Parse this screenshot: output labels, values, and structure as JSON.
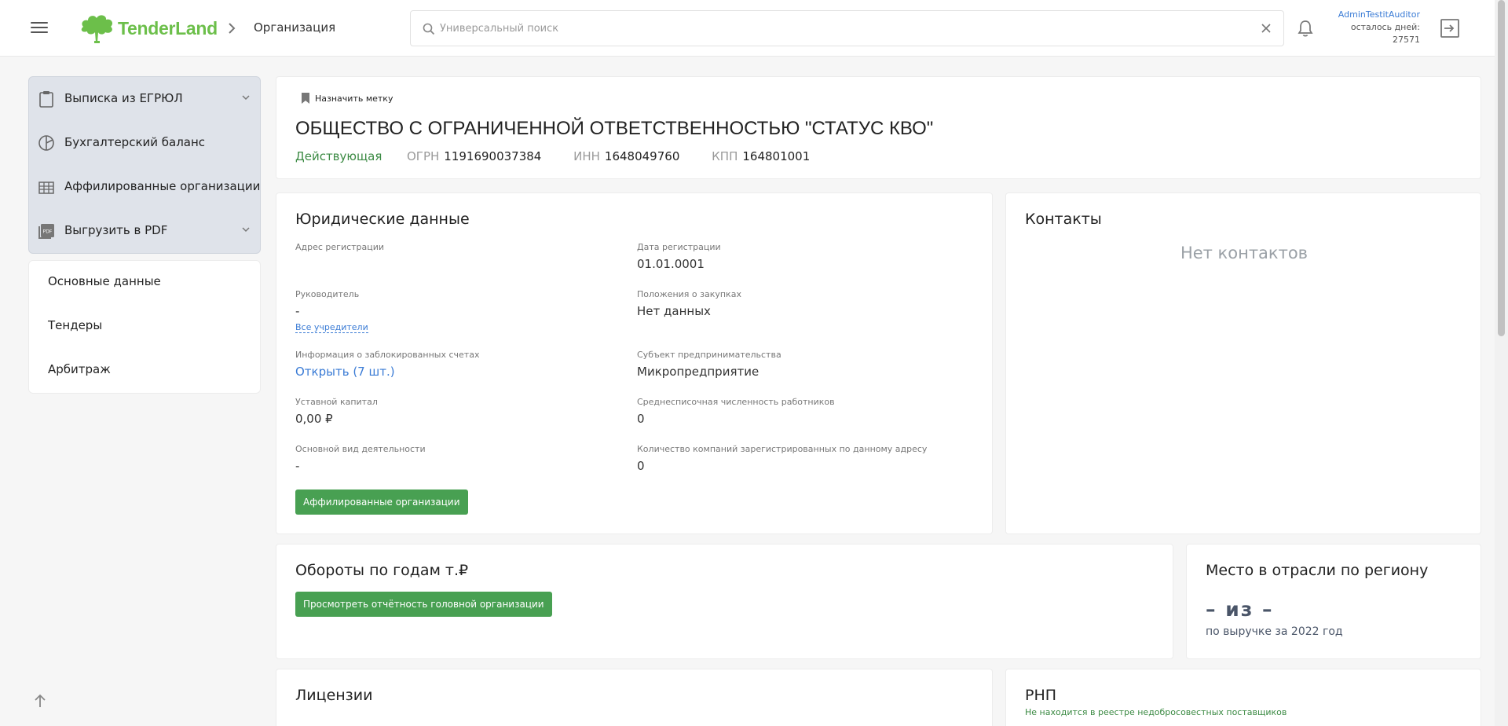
{
  "header": {
    "logo_text": "TenderLand",
    "breadcrumb": "Организация",
    "search": {
      "placeholder": "Универсальный поиск",
      "value": ""
    },
    "user": {
      "name": "AdminTestitAuditor",
      "days_label": "осталось дней:",
      "days_value": "27571"
    },
    "brand_color": "#6cbf4a"
  },
  "sidebar": {
    "tools": [
      {
        "label": "Выписка из ЕГРЮЛ",
        "icon": "clipboard-icon",
        "has_dropdown": true
      },
      {
        "label": "Бухгалтерский баланс",
        "icon": "pie-chart-icon",
        "has_dropdown": false
      },
      {
        "label": "Аффилированные организации",
        "icon": "building-icon",
        "has_dropdown": false
      },
      {
        "label": "Выгрузить в PDF",
        "icon": "pdf-icon",
        "has_dropdown": true
      }
    ],
    "nav": [
      {
        "label": "Основные данные"
      },
      {
        "label": "Тендеры"
      },
      {
        "label": "Арбитраж"
      }
    ]
  },
  "org": {
    "mark_label": "Назначить метку",
    "name": "ОБЩЕСТВО С ОГРАНИЧЕННОЙ ОТВЕТСТВЕННОСТЬЮ \"СТАТУС КВО\"",
    "status": "Действующая",
    "status_color": "#3b8a43",
    "ogrn_label": "ОГРН",
    "ogrn": "1191690037384",
    "inn_label": "ИНН",
    "inn": "1648049760",
    "kpp_label": "КПП",
    "kpp": "164801001"
  },
  "legal": {
    "title": "Юридические данные",
    "address_label": "Адрес регистрации",
    "reg_date_label": "Дата регистрации",
    "reg_date": "01.01.0001",
    "director_label": "Руководитель",
    "director": "-",
    "founders_link": "Все учредители",
    "procurement_label": "Положения о закупках",
    "procurement": "Нет данных",
    "blocked_label": "Информация о заблокированных счетах",
    "blocked_link": "Открыть (7 шт.)",
    "subject_label": "Субъект предпринимательства",
    "subject": "Микропредприятие",
    "capital_label": "Уставной капитал",
    "capital": "0,00 ₽",
    "employees_label": "Среднесписочная численность работников",
    "employees": "0",
    "activity_label": "Основной вид деятельности",
    "activity": "-",
    "companies_label": "Количество компаний зарегистрированных по данному адресу",
    "companies": "0",
    "affiliated_button": "Аффилированные организации"
  },
  "contacts": {
    "title": "Контакты",
    "empty": "Нет контактов"
  },
  "turnover": {
    "title": "Обороты по годам т.₽",
    "button": "Просмотреть отчётность головной организации"
  },
  "rank": {
    "title": "Место в отрасли по региону",
    "value": "– из –",
    "subtitle": "по выручке за 2022 год"
  },
  "licenses": {
    "title": "Лицензии"
  },
  "rnp": {
    "title": "РНП",
    "subtitle": "Не находится в реестре недобросовестных поставщиков"
  }
}
